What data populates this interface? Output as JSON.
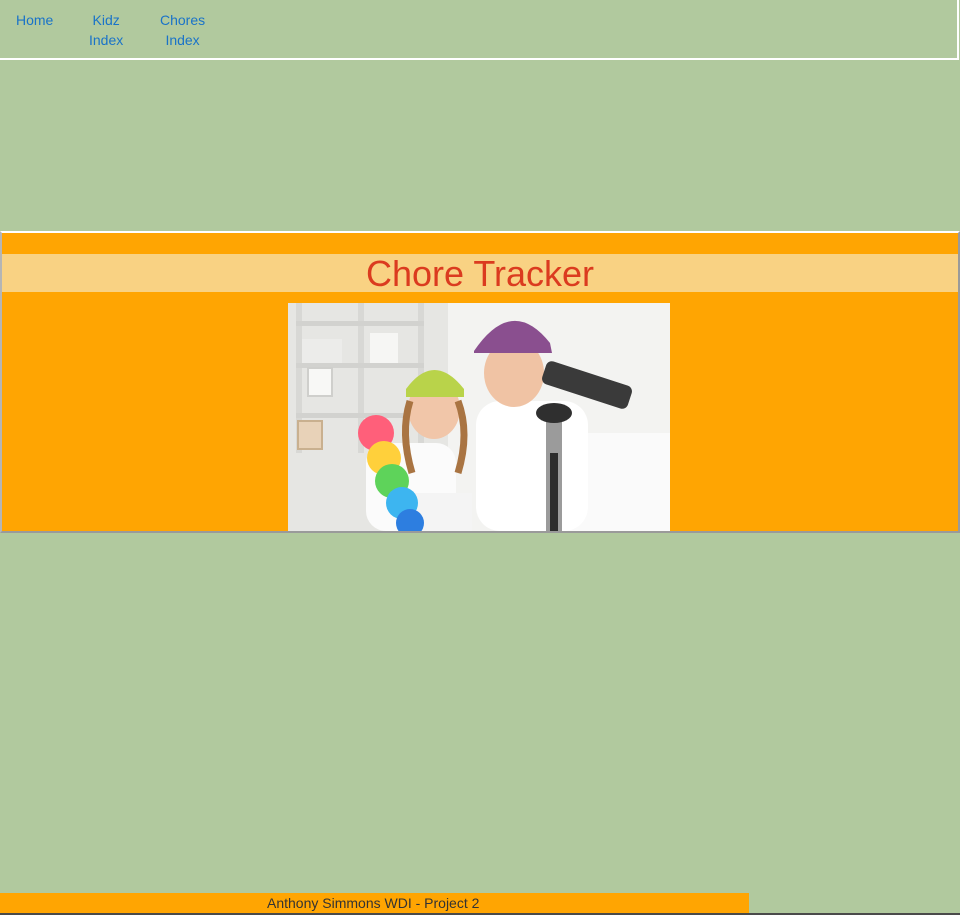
{
  "nav": {
    "home": "Home",
    "kidz": [
      "Kidz",
      "Index"
    ],
    "chores": [
      "Chores",
      "Index"
    ]
  },
  "hero": {
    "title": "Chore Tracker",
    "image_alt": "two kids with a feather duster and a vacuum cleaner"
  },
  "footer": {
    "text": "Anthony Simmons WDI - Project 2"
  },
  "colors": {
    "page_background": "#b1c99e",
    "hero_background": "#ffa502",
    "title_band": "#f9d283",
    "title_text": "#db3b1f",
    "link": "#1a73c8"
  }
}
